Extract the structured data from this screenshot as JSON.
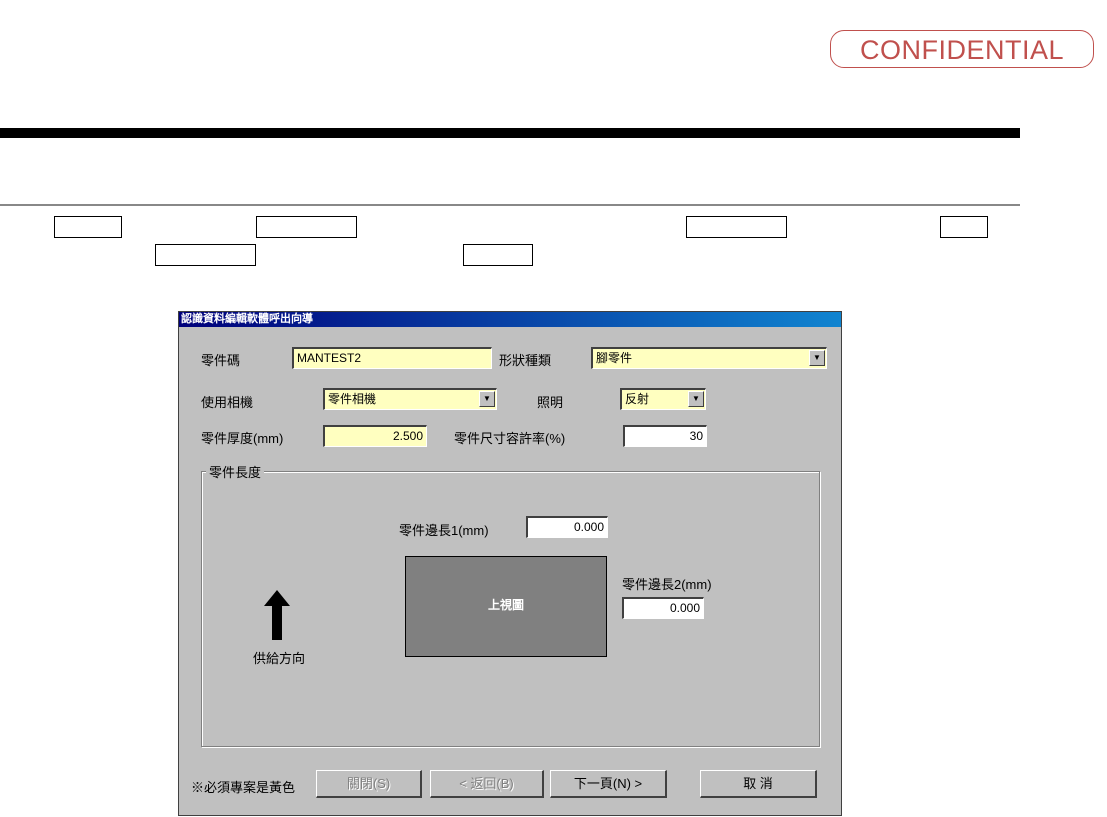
{
  "doc": {
    "confidential": "CONFIDENTIAL"
  },
  "dialog": {
    "title": "認識資料編輯軟體呼出向導",
    "part_code_label": "零件碼",
    "part_code_value": "MANTEST2",
    "shape_type_label": "形狀種類",
    "shape_type_value": "腳零件",
    "camera_label": "使用相機",
    "camera_value": "零件相機",
    "lighting_label": "照明",
    "lighting_value": "反射",
    "thickness_label": "零件厚度(mm)",
    "thickness_value": "2.500",
    "tolerance_label": "零件尺寸容許率(%)",
    "tolerance_value": "30",
    "group_title": "零件長度",
    "side1_label": "零件邊長1(mm)",
    "side1_value": "0.000",
    "side2_label": "零件邊長2(mm)",
    "side2_value": "0.000",
    "top_view_label": "上視圖",
    "feed_direction_label": "供給方向",
    "required_note": "※必須專案是黃色",
    "buttons": {
      "close": "關閉(S)",
      "back": "< 返回(B)",
      "next": "下一頁(N) >",
      "cancel": "取 消"
    }
  },
  "colors": {
    "required_field": "#ffffc0",
    "dialog_bg": "#c0c0c0",
    "confidential": "#c0504d"
  }
}
